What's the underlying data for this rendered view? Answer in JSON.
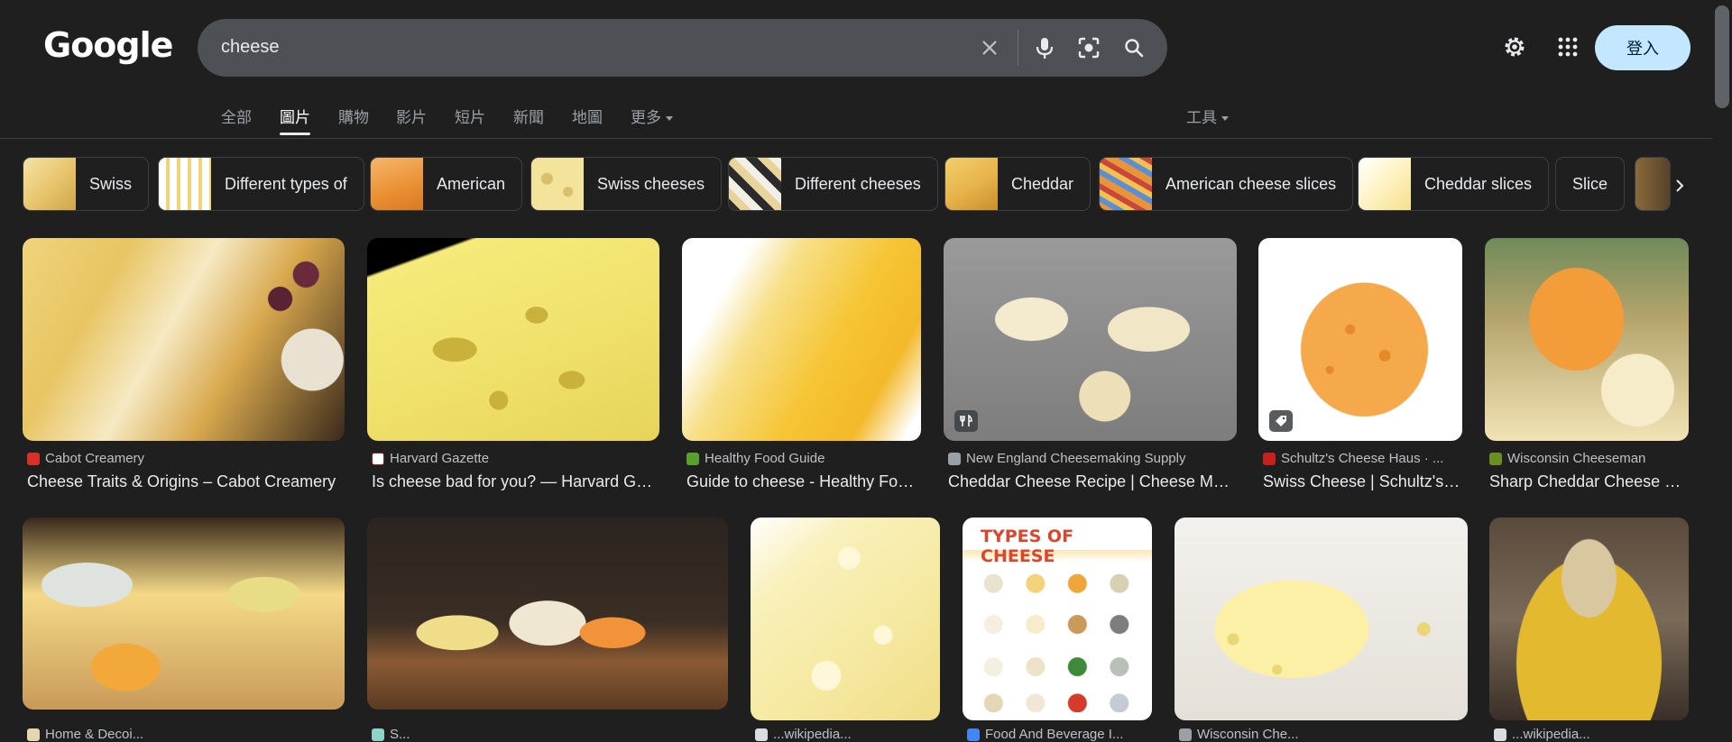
{
  "header": {
    "logo": "Google",
    "search": {
      "value": "cheese"
    },
    "signin_label": "登入",
    "icons": [
      "clear-icon",
      "mic-icon",
      "lens-icon",
      "search-icon",
      "settings-icon",
      "apps-icon"
    ]
  },
  "tabs": [
    {
      "label": "全部"
    },
    {
      "label": "圖片",
      "active": true
    },
    {
      "label": "購物"
    },
    {
      "label": "影片"
    },
    {
      "label": "短片"
    },
    {
      "label": "新聞"
    },
    {
      "label": "地圖"
    },
    {
      "label": "更多"
    }
  ],
  "tools_label": "工具",
  "chips": [
    {
      "label": "Swiss"
    },
    {
      "label": "Different types of"
    },
    {
      "label": "American"
    },
    {
      "label": "Swiss cheeses"
    },
    {
      "label": "Different cheeses"
    },
    {
      "label": "Cheddar"
    },
    {
      "label": "American cheese slices"
    },
    {
      "label": "Cheddar slices"
    },
    {
      "label": "Slice"
    }
  ],
  "results": [
    {
      "source": "Cabot Creamery",
      "title": "Cheese Traits & Origins – Cabot Creamery",
      "favicon_color": "#d93025"
    },
    {
      "source": "Harvard Gazette",
      "title": "Is cheese bad for you? — Harvard Gazette",
      "favicon_color": "#ffffff"
    },
    {
      "source": "Healthy Food Guide",
      "title": "Guide to cheese - Healthy Food Guide",
      "favicon_color": "#5aa02c"
    },
    {
      "source": "New England Cheesemaking Supply",
      "title": "Cheddar Cheese Recipe | Cheese Making",
      "favicon_color": "#9aa0a6",
      "badge": "recipe-icon"
    },
    {
      "source": "Schultz's Cheese Haus · ...",
      "title": "Swiss Cheese | Schultz's Cheese Haus",
      "favicon_color": "#c5221f",
      "badge": "tag-icon"
    },
    {
      "source": "Wisconsin Cheeseman",
      "title": "Sharp Cheddar Cheese Wedge",
      "favicon_color": "#6b8e23"
    },
    {
      "source": "Home & Decoi...",
      "title": "",
      "favicon_color": "#e3d7b0"
    },
    {
      "source": "S...",
      "title": "",
      "favicon_color": "#8dd3c7"
    },
    {
      "source": "...wikipedia...",
      "title": "",
      "favicon_color": "#dadce0"
    },
    {
      "source": "Food And Beverage I...",
      "title": "",
      "favicon_color": "#4285f4"
    },
    {
      "source": "Wisconsin Che...",
      "title": "",
      "favicon_color": "#9aa0a6"
    },
    {
      "source": "...wikipedia...",
      "title": "",
      "favicon_color": "#dadce0"
    }
  ],
  "colors": {
    "background": "#1f1f1f",
    "search_bg": "#4d5156",
    "signin_bg": "#c2e7ff",
    "text": "#e8eaed",
    "muted": "#9aa0a6"
  }
}
